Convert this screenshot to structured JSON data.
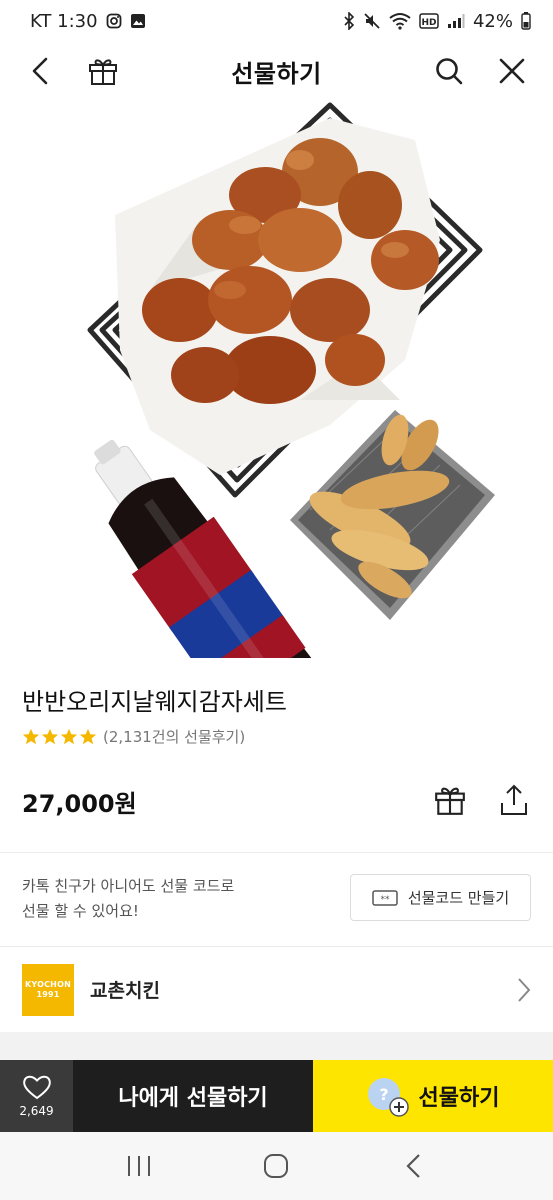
{
  "status_bar": {
    "carrier_time": "KT 1:30",
    "battery": "42%"
  },
  "header": {
    "title": "선물하기",
    "icons": [
      "back-icon",
      "gift-box-icon",
      "search-icon",
      "close-icon"
    ]
  },
  "product": {
    "name": "반반오리지날웨지감자세트",
    "rating_stars": 4,
    "reviews": "(2,131건의 선물후기)",
    "price": "27,000원"
  },
  "gift_code": {
    "description_line1": "카톡 친구가 아니어도 선물 코드로",
    "description_line2": "선물 할 수 있어요!",
    "button_label": "선물코드 만들기"
  },
  "brand": {
    "logo_line1": "KYOCHON",
    "logo_line2": "1991",
    "name": "교촌치킨"
  },
  "bottom_bar": {
    "like_count": "2,649",
    "gift_self_label": "나에게 선물하기",
    "gift_label": "선물하기"
  },
  "colors": {
    "accent_yellow": "#fee500",
    "dark_button": "#1e1e1e",
    "star": "#f5b800",
    "brand_logo": "#f5b800"
  }
}
